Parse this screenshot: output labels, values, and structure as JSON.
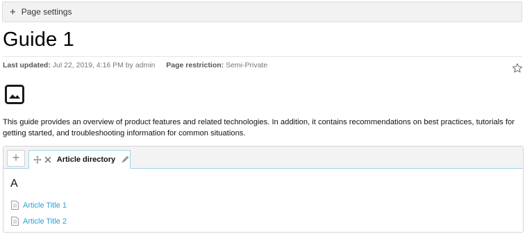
{
  "settings": {
    "icon": "plus-icon",
    "label": "Page settings"
  },
  "page": {
    "title": "Guide 1",
    "meta": {
      "updated_label": "Last updated:",
      "updated_value": "Jul 22, 2019, 4:16 PM by admin",
      "restriction_label": "Page restriction:",
      "restriction_value": "Semi-Private"
    },
    "favorite_icon": "star-outline-icon",
    "image_icon": "image-placeholder-icon",
    "description": "This guide provides an overview of product features and related technologies. In addition, it contains recommendations on best practices, tutorials for getting started, and troubleshooting information for common situations."
  },
  "panel": {
    "add_tab_label": "+",
    "tab": {
      "label": "Article directory",
      "icons": [
        "move-icon",
        "close-icon",
        "pencil-icon"
      ]
    },
    "section_letter": "A",
    "articles": [
      {
        "title": "Article Title 1",
        "icon": "document-icon"
      },
      {
        "title": "Article Title 2",
        "icon": "document-icon"
      }
    ]
  },
  "colors": {
    "link": "#2a9fd6",
    "tab_border": "#9fd3ec",
    "settings_bg": "#f2f2f2"
  }
}
